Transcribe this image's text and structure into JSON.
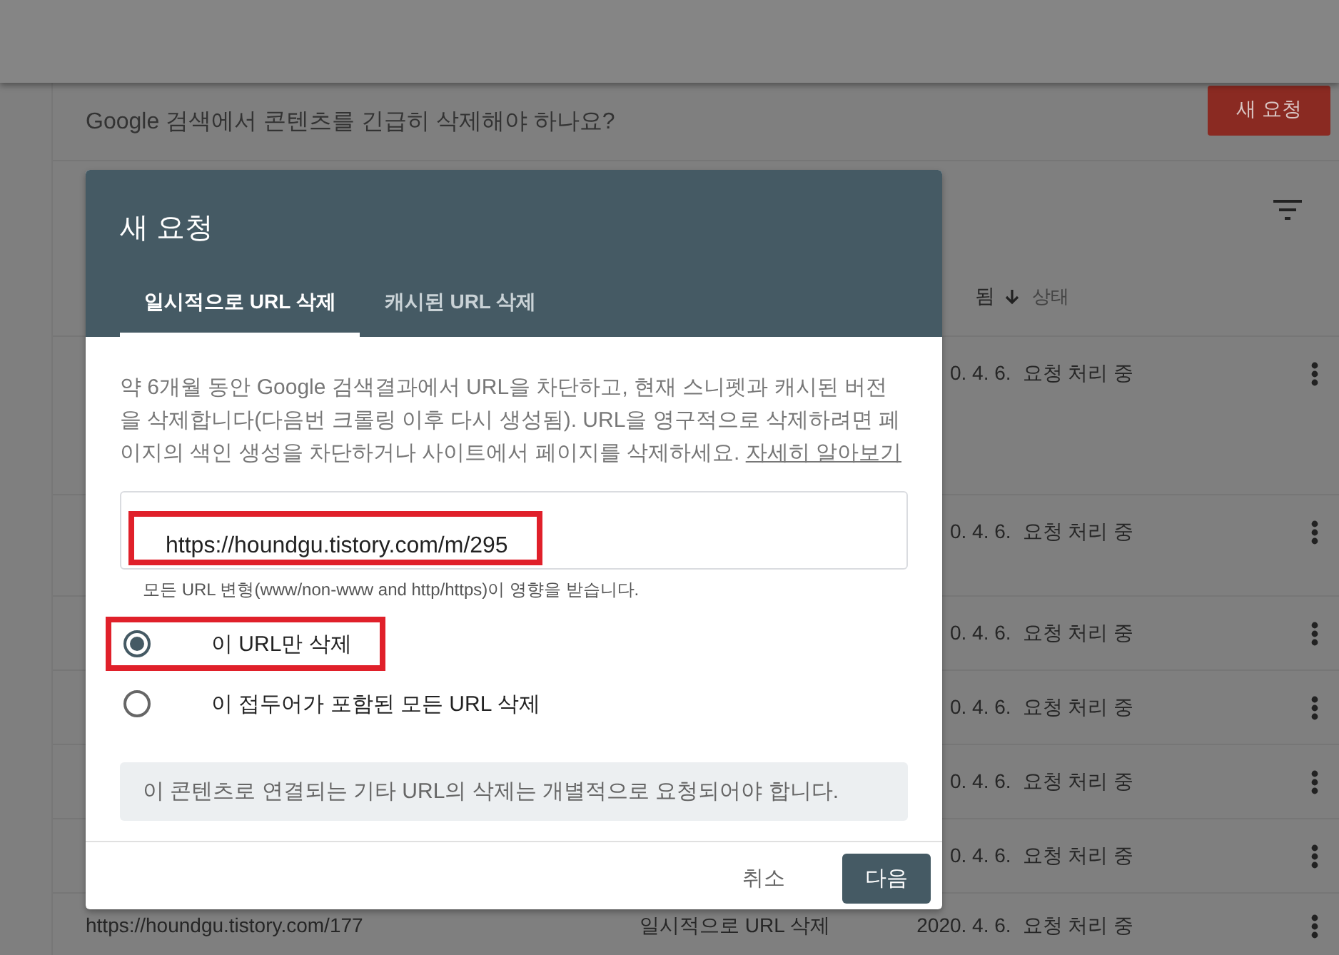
{
  "page": {
    "banner_text": "Google 검색에서 콘텐츠를 긴급히 삭제해야 하나요?",
    "new_request_button": "새 요청"
  },
  "table": {
    "columns": [
      {
        "label": "됨"
      },
      {
        "label": "상태"
      }
    ],
    "rows": [
      {
        "date": "0. 4. 6.",
        "status": "요청 처리 중"
      },
      {
        "date": "0. 4. 6.",
        "status": "요청 처리 중"
      },
      {
        "date": "0. 4. 6.",
        "status": "요청 처리 중"
      },
      {
        "date": "0. 4. 6.",
        "status": "요청 처리 중"
      },
      {
        "date": "0. 4. 6.",
        "status": "요청 처리 중"
      },
      {
        "date": "0. 4. 6.",
        "status": "요청 처리 중"
      },
      {
        "url": "https://houndgu.tistory.com/177",
        "type": "일시적으로 URL 삭제",
        "date": "2020. 4. 6.",
        "status": "요청 처리 중"
      }
    ]
  },
  "dialog": {
    "title": "새 요청",
    "tabs": [
      {
        "label": "일시적으로 URL 삭제",
        "selected": true
      },
      {
        "label": "캐시된 URL 삭제",
        "selected": false
      }
    ],
    "description": "약 6개월 동안 Google 검색결과에서 URL을 차단하고, 현재 스니펫과 캐시된 버전을 삭제합니다(다음번 크롤링 이후 다시 생성됨). URL을 영구적으로 삭제하려면 페이지의 색인 생성을 차단하거나 사이트에서 페이지를 삭제하세요.",
    "learn_more_link": "자세히 알아보기",
    "url_field": {
      "value": "https://houndgu.tistory.com/m/295",
      "highlighted": true
    },
    "helper_text": "모든 URL 변형(www/non-www and http/https)이 영향을 받습니다.",
    "options": [
      {
        "label": "이 URL만 삭제",
        "selected": true,
        "highlighted": true
      },
      {
        "label": "이 접두어가 포함된 모든 URL 삭제",
        "selected": false,
        "highlighted": false
      }
    ],
    "notice": "이 콘텐츠로 연결되는 기타 URL의 삭제는 개별적으로 요청되어야 합니다.",
    "buttons": [
      {
        "label": "취소",
        "kind": "text"
      },
      {
        "label": "다음",
        "kind": "primary"
      }
    ]
  }
}
